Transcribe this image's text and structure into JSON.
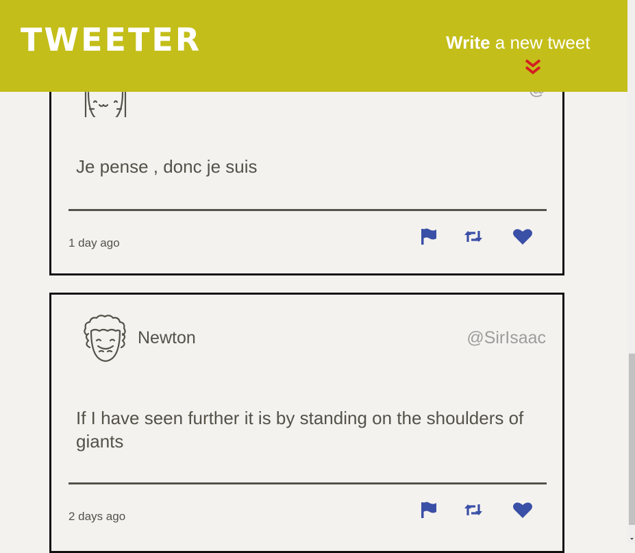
{
  "header": {
    "logo": "TWEETER",
    "compose_bold": "Write",
    "compose_rest": " a new tweet",
    "accent_color": "#c3be1a",
    "chevron_color": "#d22020"
  },
  "tweets": [
    {
      "name": "",
      "handle": "@",
      "avatar_icon": "smiling-girl-avatar-icon",
      "text": "Je pense , donc je suis",
      "time": "1 day ago"
    },
    {
      "name": "Newton",
      "handle": "@SirIsaac",
      "avatar_icon": "curly-hair-man-avatar-icon",
      "text": "If I have seen further it is by standing on the shoulders of giants",
      "time": "2 days ago"
    }
  ],
  "actions": {
    "icons": [
      "flag-icon",
      "retweet-icon",
      "heart-icon"
    ],
    "color": "#3a4fa6"
  }
}
